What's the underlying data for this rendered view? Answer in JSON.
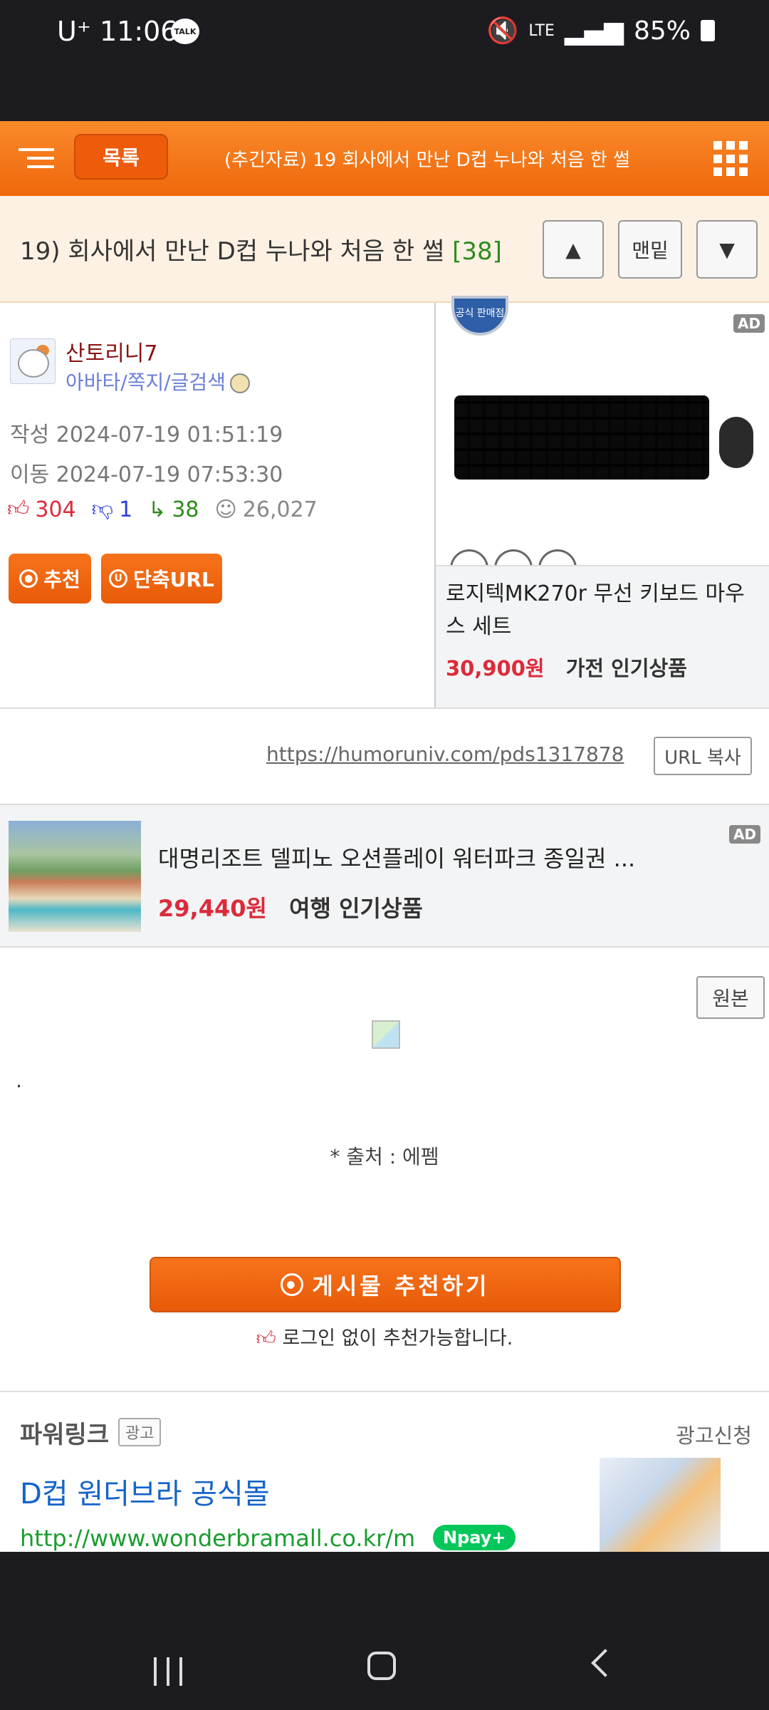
{
  "status_bar": {
    "carrier": "U⁺",
    "time": "11:06",
    "talk": "TALK",
    "network": "LTE",
    "battery": "85%"
  },
  "top_bar": {
    "list_label": "목록",
    "title": "(추긴자료) 19 회사에서 만난 D컵 누나와 처음 한 썰"
  },
  "post": {
    "title": "19) 회사에서 만난 D컵 누나와 처음 한 썰",
    "comment_count": "[38]",
    "top_label": "▲",
    "bottom_label": "맨밑",
    "down_label": "▼"
  },
  "author": {
    "name": "산토리니7",
    "links": "아바타/쪽지/글검색",
    "written": "작성 2024-07-19 01:51:19",
    "moved": "이동 2024-07-19 07:53:30",
    "likes": "304",
    "dislikes": "1",
    "replies": "38",
    "views": "26,027",
    "recommend_label": "추천",
    "short_url_label": "단축URL"
  },
  "ad_product": {
    "ad": "AD",
    "seal": "공식 판매점",
    "name": "로지텍MK270r 무선 키보드 마우스 세트",
    "price": "30,900원",
    "category": "가전 인기상품"
  },
  "url_row": {
    "url": "https://humoruniv.com/pds1317878",
    "copy_label": "URL 복사"
  },
  "ad_travel": {
    "ad": "AD",
    "name": "대명리조트 델피노 오션플레이 워터파크 종일권 ...",
    "price": "29,440원",
    "category": "여행 인기상품"
  },
  "content": {
    "original_label": "원본",
    "dot": ".",
    "source": "* 출처 : 에펨",
    "recommend_big": "게시물  추천하기",
    "no_login": "로그인 없이 추천가능합니다."
  },
  "powerlink": {
    "title": "파워링크",
    "ad_badge": "광고",
    "apply": "광고신청",
    "headline": "D컵 원더브라 공식몰",
    "url": "http://www.wonderbramall.co.kr/m",
    "npay": "Npay+"
  },
  "colors": {
    "accent": "#f0670b",
    "like": "#dd2a3a",
    "dislike": "#2b3fd6",
    "reply": "#2e8b1e",
    "link": "#1463c9"
  }
}
